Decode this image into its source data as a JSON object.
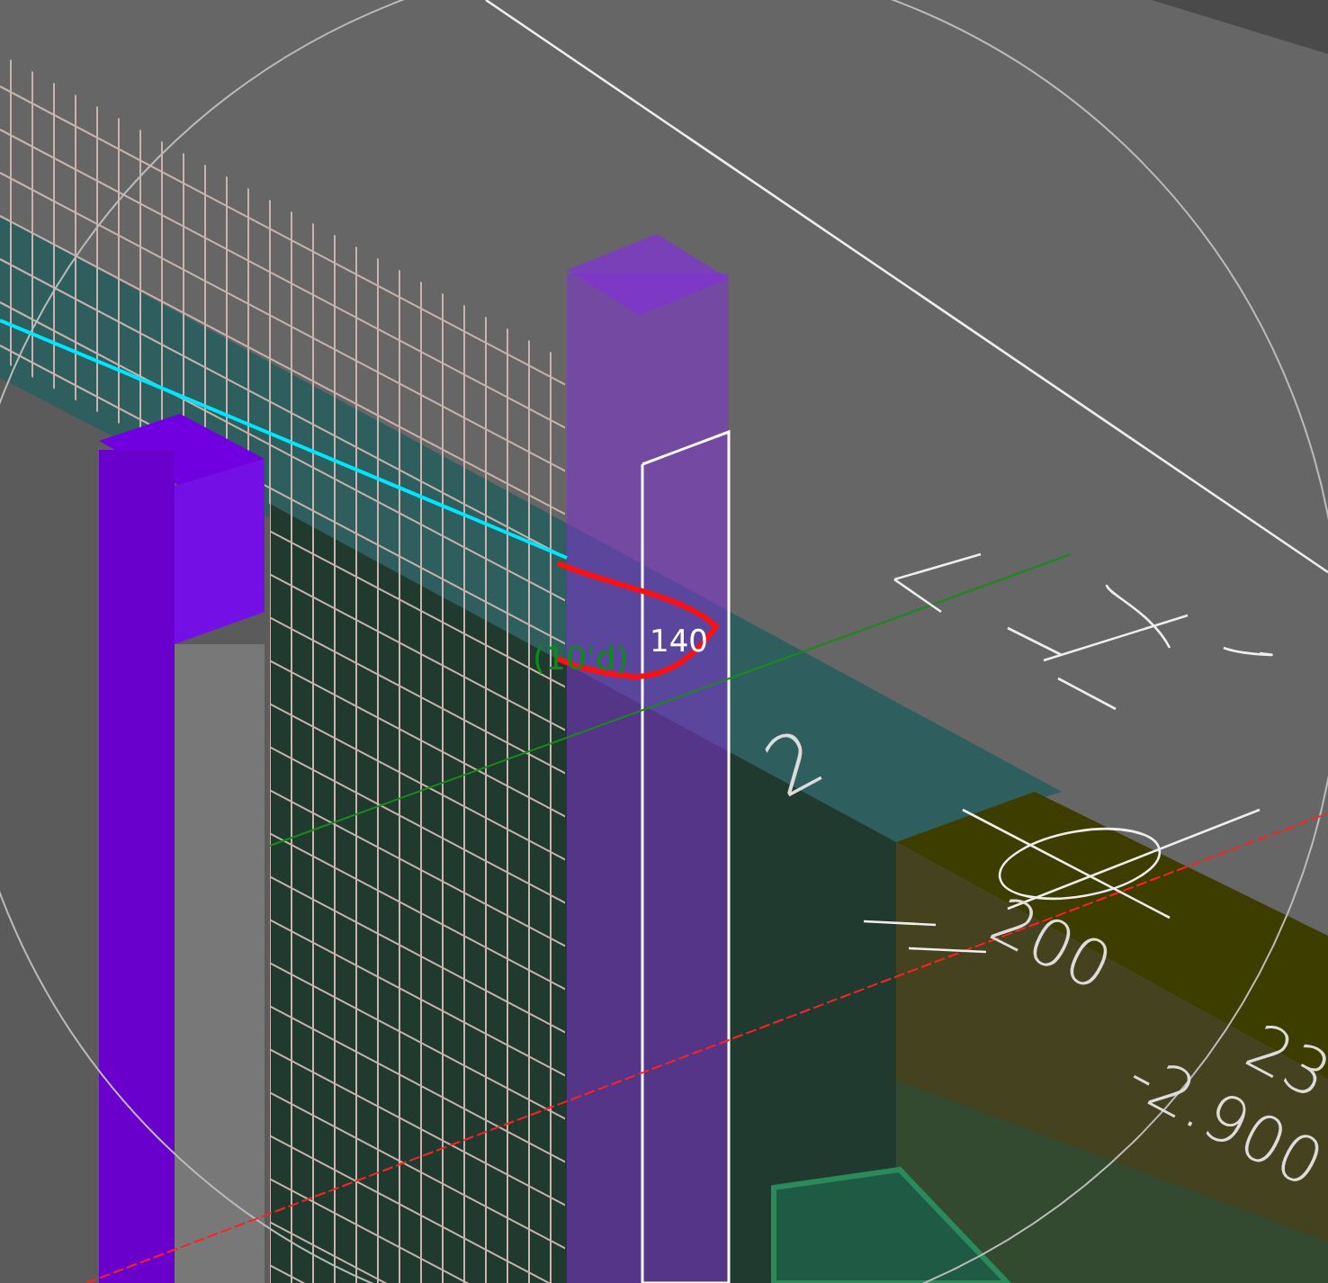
{
  "viewport": {
    "labels": [
      {
        "kind": "dimension",
        "text": "140"
      },
      {
        "kind": "tag",
        "text": "(10'd)"
      },
      {
        "kind": "annotation",
        "text": "2"
      },
      {
        "kind": "annotation",
        "text": "200"
      },
      {
        "kind": "annotation",
        "text": "-2.900"
      },
      {
        "kind": "annotation",
        "text": "23"
      }
    ]
  }
}
